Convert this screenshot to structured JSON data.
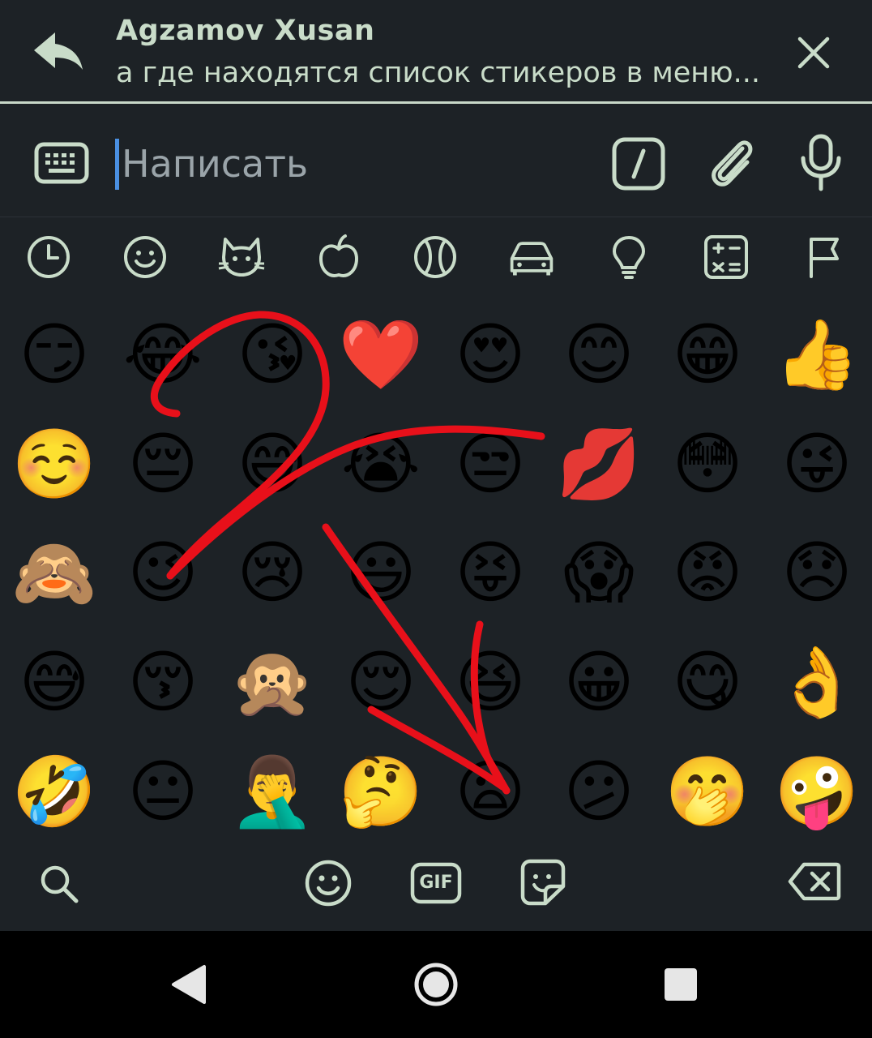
{
  "reply": {
    "author": "Agzamov Xusan",
    "text": "а где находятся список стикеров в меню..."
  },
  "composer": {
    "placeholder": "Написать"
  },
  "categories": [
    "recent",
    "smileys",
    "animals",
    "food",
    "activity",
    "travel",
    "objects",
    "symbols",
    "flags"
  ],
  "emojis": [
    [
      "😏",
      "😂",
      "😘",
      "❤️",
      "😍",
      "😊",
      "😁",
      "👍"
    ],
    [
      "☺️",
      "😔",
      "😅",
      "😭",
      "😒",
      "💋",
      "😳",
      "😜"
    ],
    [
      "🙈",
      "😉",
      "😢",
      "😃",
      "😝",
      "😱",
      "😡",
      "😞"
    ],
    [
      "😅",
      "😚",
      "🙊",
      "😌",
      "😆",
      "😀",
      "😋",
      "👌"
    ],
    [
      "🤣",
      "😐",
      "🤦‍♂️",
      "🤔",
      "😦",
      "😕",
      "🤭",
      "🤪"
    ]
  ],
  "colors": {
    "background": "#1d2226",
    "icon": "#c9dcc9",
    "caret": "#4a90e2",
    "annotation": "#e8101a"
  },
  "tools": {
    "gif_label": "GIF"
  }
}
